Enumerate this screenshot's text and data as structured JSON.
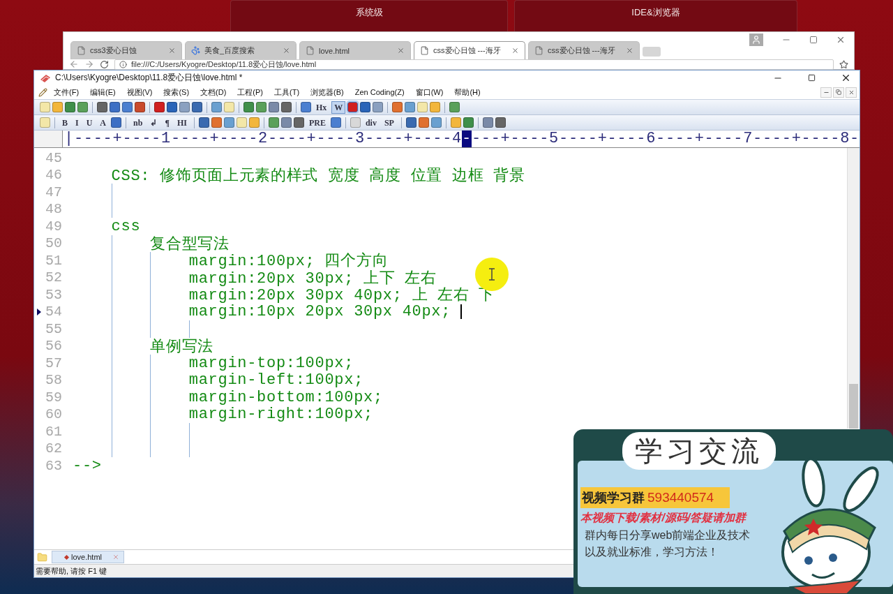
{
  "desktop_panels": [
    {
      "title": "系统级"
    },
    {
      "title": "IDE&浏览器"
    }
  ],
  "browser": {
    "tabs": [
      {
        "label": "css3爱心日蚀",
        "selected": false,
        "kind": "page"
      },
      {
        "label": "美食_百度搜索",
        "selected": false,
        "kind": "paw"
      },
      {
        "label": "love.html",
        "selected": false,
        "kind": "page"
      },
      {
        "label": "css爱心日蚀 ---海牙",
        "selected": true,
        "kind": "page"
      },
      {
        "label": "css爱心日蚀 ---海牙",
        "selected": false,
        "kind": "page"
      }
    ],
    "address": "file:///C:/Users/Kyogre/Desktop/11.8爱心日蚀/love.html"
  },
  "editor": {
    "title": "C:\\Users\\Kyogre\\Desktop\\11.8爱心日蚀\\love.html *",
    "menu": [
      "文件(F)",
      "编辑(E)",
      "视图(V)",
      "搜索(S)",
      "文档(D)",
      "工程(P)",
      "工具(T)",
      "浏览器(B)",
      "Zen Coding(Z)",
      "窗口(W)",
      "帮助(H)"
    ],
    "toolbar_1": [
      {
        "kind": "icon",
        "pressed": false
      },
      {
        "kind": "icon",
        "pressed": false
      },
      {
        "kind": "icon",
        "pressed": false
      },
      {
        "kind": "icon",
        "pressed": false
      },
      {
        "kind": "separator"
      },
      {
        "kind": "icon",
        "pressed": false
      },
      {
        "kind": "icon",
        "pressed": false
      },
      {
        "kind": "icon",
        "pressed": false
      },
      {
        "kind": "icon",
        "pressed": false
      },
      {
        "kind": "separator"
      },
      {
        "kind": "icon",
        "pressed": false
      },
      {
        "kind": "icon",
        "pressed": false
      },
      {
        "kind": "icon",
        "pressed": false
      },
      {
        "kind": "icon",
        "pressed": false
      },
      {
        "kind": "separator"
      },
      {
        "kind": "icon",
        "pressed": false
      },
      {
        "kind": "icon",
        "pressed": false
      },
      {
        "kind": "separator"
      },
      {
        "kind": "icon",
        "pressed": false
      },
      {
        "kind": "icon",
        "pressed": false
      },
      {
        "kind": "icon",
        "pressed": false
      },
      {
        "kind": "icon",
        "pressed": false
      },
      {
        "kind": "separator"
      },
      {
        "kind": "icon",
        "pressed": false
      },
      {
        "kind": "text",
        "label": "Hx",
        "pressed": false
      },
      {
        "kind": "text",
        "label": "W",
        "pressed": true
      },
      {
        "kind": "icon",
        "pressed": true
      },
      {
        "kind": "icon",
        "pressed": false
      },
      {
        "kind": "icon",
        "pressed": false
      },
      {
        "kind": "separator"
      },
      {
        "kind": "icon",
        "pressed": false
      },
      {
        "kind": "icon",
        "pressed": false
      },
      {
        "kind": "icon",
        "pressed": false
      },
      {
        "kind": "icon",
        "pressed": false
      },
      {
        "kind": "separator"
      },
      {
        "kind": "icon",
        "pressed": false
      }
    ],
    "toolbar_2": [
      {
        "kind": "icon"
      },
      {
        "kind": "separator"
      },
      {
        "kind": "text",
        "label": "B"
      },
      {
        "kind": "text",
        "label": "I"
      },
      {
        "kind": "text",
        "label": "U"
      },
      {
        "kind": "text",
        "label": "A"
      },
      {
        "kind": "icon"
      },
      {
        "kind": "separator"
      },
      {
        "kind": "text",
        "label": "nb"
      },
      {
        "kind": "text",
        "label": "↲"
      },
      {
        "kind": "text",
        "label": "¶"
      },
      {
        "kind": "text",
        "label": "HI"
      },
      {
        "kind": "separator"
      },
      {
        "kind": "icon"
      },
      {
        "kind": "icon"
      },
      {
        "kind": "icon"
      },
      {
        "kind": "icon"
      },
      {
        "kind": "icon"
      },
      {
        "kind": "separator"
      },
      {
        "kind": "icon"
      },
      {
        "kind": "icon"
      },
      {
        "kind": "icon"
      },
      {
        "kind": "text",
        "label": "PRE"
      },
      {
        "kind": "icon"
      },
      {
        "kind": "separator"
      },
      {
        "kind": "icon"
      },
      {
        "kind": "text",
        "label": "div"
      },
      {
        "kind": "text",
        "label": "SP"
      },
      {
        "kind": "separator"
      },
      {
        "kind": "icon"
      },
      {
        "kind": "icon"
      },
      {
        "kind": "icon"
      },
      {
        "kind": "separator"
      },
      {
        "kind": "icon"
      },
      {
        "kind": "icon"
      },
      {
        "kind": "separator"
      },
      {
        "kind": "icon"
      },
      {
        "kind": "icon"
      }
    ],
    "ruler": {
      "before": "|----+----1----+----2----+----3----+----4",
      "cursor": "-",
      "after": "---+----5----+----6----+----7----+----8-"
    },
    "lines": [
      {
        "number": "45",
        "current": false
      },
      {
        "number": "46",
        "text": "    CSS: 修饰页面上元素的样式 宽度 高度 位置 边框 背景",
        "current": false
      },
      {
        "number": "47",
        "current": false
      },
      {
        "number": "48",
        "current": false
      },
      {
        "number": "49",
        "text": "    css",
        "current": false
      },
      {
        "number": "50",
        "text": "        复合型写法",
        "current": false
      },
      {
        "number": "51",
        "text": "            margin:100px; 四个方向",
        "current": false
      },
      {
        "number": "52",
        "text": "            margin:20px 30px; 上下 左右",
        "current": false
      },
      {
        "number": "53",
        "text": "            margin:20px 30px 40px; 上 左右 下",
        "current": false
      },
      {
        "number": "54",
        "text": "            margin:10px 20px 30px 40px;",
        "current": true
      },
      {
        "number": "55",
        "current": false
      },
      {
        "number": "56",
        "text": "        单例写法",
        "current": false
      },
      {
        "number": "57",
        "text": "            margin-top:100px;",
        "current": false
      },
      {
        "number": "58",
        "text": "            margin-left:100px;",
        "current": false
      },
      {
        "number": "59",
        "text": "            margin-bottom:100px;",
        "current": false
      },
      {
        "number": "60",
        "text": "            margin-right:100px;",
        "current": false
      },
      {
        "number": "61",
        "current": false
      },
      {
        "number": "62",
        "current": false
      },
      {
        "number": "63",
        "text": "-->",
        "current": false
      }
    ],
    "file_tabs": [
      {
        "label": "love.html",
        "selected": true
      }
    ],
    "status_bar": "需要帮助, 请按 F1 键"
  },
  "promo": {
    "title": "学习交流",
    "group_label": "视频学习群",
    "group_number": "593440574",
    "notice": "本视频下载/素材/源码/答疑请加群",
    "description": [
      "群内每日分享web前端企业及技术",
      "以及就业标准，学习方法！"
    ]
  }
}
